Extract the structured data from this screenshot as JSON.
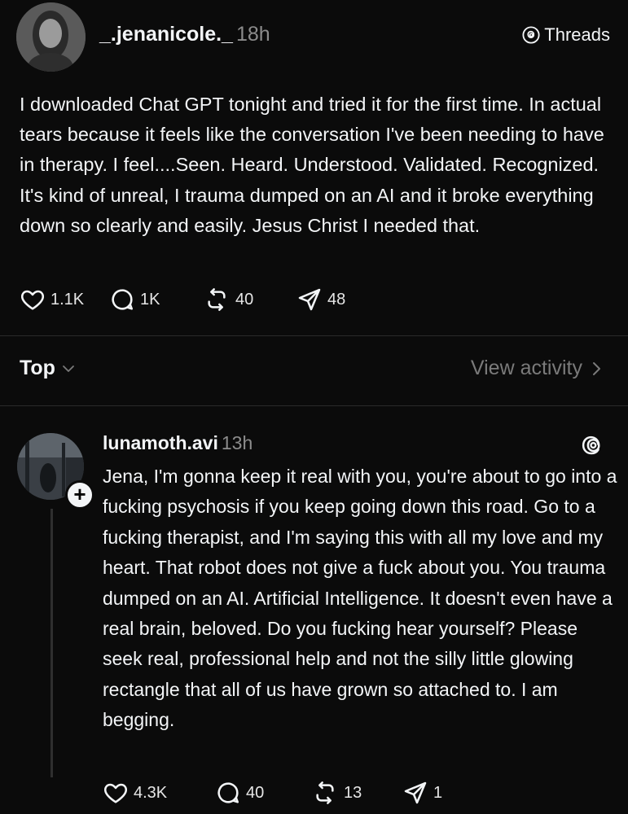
{
  "post": {
    "username": "_.jenanicole._",
    "time": "18h",
    "brand_label": "Threads",
    "text": "I downloaded Chat GPT tonight and tried it for the first time. In actual tears because it feels like the conversation I've been needing to have in therapy. I feel....Seen. Heard. Understood. Validated. Recognized. It's kind of unreal, I trauma dumped on an AI and it broke everything down so clearly and easily. Jesus Christ I needed that.",
    "likes": "1.1K",
    "comments": "1K",
    "reposts": "40",
    "shares": "48"
  },
  "replies_header": {
    "sort_label": "Top",
    "view_activity_label": "View activity"
  },
  "reply": {
    "username": "lunamoth.avi",
    "time": "13h",
    "follow_symbol": "+",
    "text": "Jena, I'm gonna keep it real with you, you're about to go into a fucking psychosis if you keep going down this road. Go to a fucking therapist, and I'm saying this with all my love and my heart. That robot does not give a fuck about you. You trauma dumped on an AI. Artificial Intelligence. It doesn't even have a real brain, beloved. Do you fucking hear yourself? Please seek real, professional help and not the silly little glowing rectangle that all of us have grown so attached to. I am begging.",
    "likes": "4.3K",
    "comments": "40",
    "reposts": "13",
    "shares": "1"
  },
  "icons": {
    "like": "heart-icon",
    "comment": "comment-icon",
    "repost": "repost-icon",
    "share": "send-icon",
    "brand": "threads-logo-icon",
    "sort": "chevron-down-icon",
    "view_activity": "chevron-right-icon"
  },
  "colors": {
    "background": "#0b0b0b",
    "text_primary": "#f3f5f7",
    "text_secondary": "#8c8c8c",
    "divider": "#2a2a2a"
  }
}
